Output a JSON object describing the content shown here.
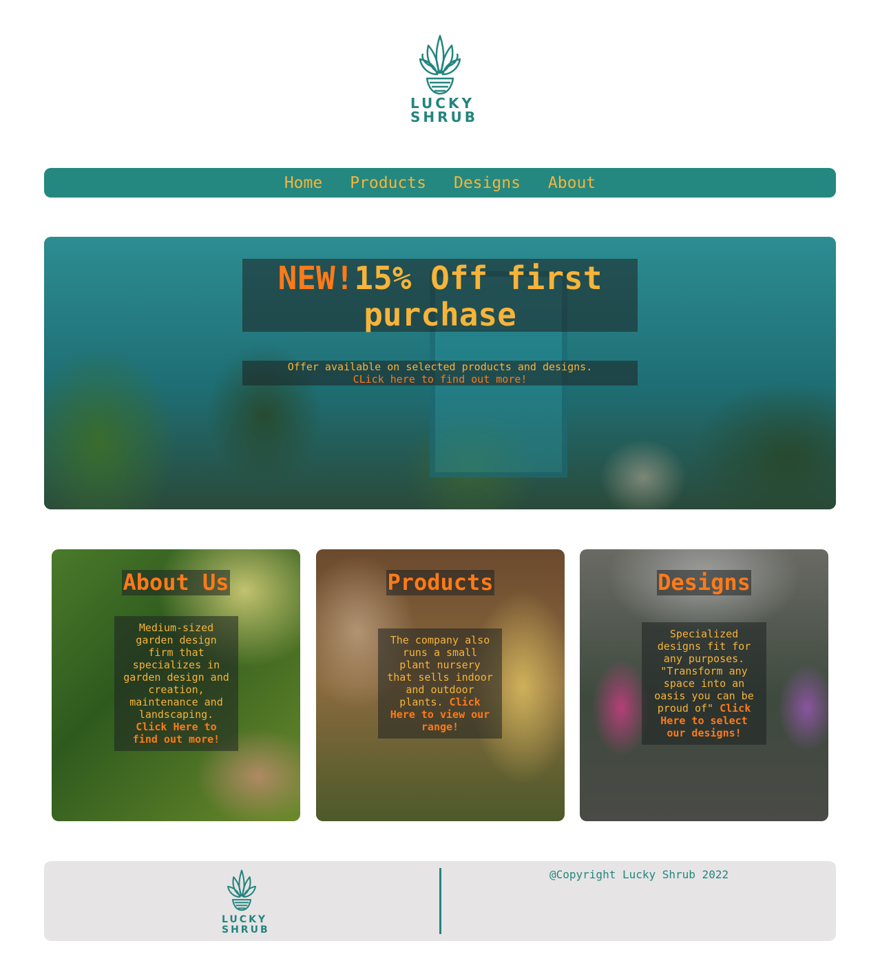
{
  "brand": {
    "line1": "LUCKY",
    "line2": "SHRUB",
    "color": "#23857e"
  },
  "nav": {
    "items": [
      "Home",
      "Products",
      "Designs",
      "About"
    ],
    "bg": "#248880",
    "text_color": "#f7b43a"
  },
  "hero": {
    "title_new": "NEW!",
    "title_rest": "15% Off first purchase",
    "sub_line1": "Offer available on selected products and designs.",
    "sub_link": "CLick here to find out more!"
  },
  "cards": [
    {
      "title": "About Us",
      "text": "Medium-sized garden design firm that specializes in garden design and creation, maintenance and landscaping.",
      "link": "Click Here to find out more!"
    },
    {
      "title": "Products",
      "text": "The company also runs a small plant nursery that sells indoor and outdoor plants.",
      "link": "Click Here to view our range!"
    },
    {
      "title": "Designs",
      "text": "Specialized designs fit for any purposes. \"Transform any space into an oasis you can be proud of\"",
      "link": "Click Here to select our designs!"
    }
  ],
  "footer": {
    "copyright": "@Copyright Lucky Shrub 2022"
  },
  "colors": {
    "accent_orange": "#ff7a18",
    "accent_yellow": "#f7b43a",
    "teal": "#248880"
  }
}
